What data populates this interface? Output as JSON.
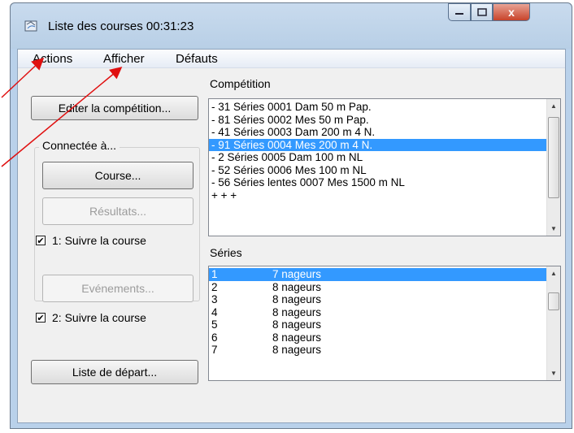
{
  "window": {
    "title": "Liste des courses  00:31:23",
    "close_glyph": "x"
  },
  "menu": {
    "items": [
      "Actions",
      "Afficher",
      "Défauts"
    ]
  },
  "left_panel": {
    "edit_button": "Editer la compétition...",
    "group_label": "Connectée à...",
    "course_button": "Course...",
    "results_button": "Résultats...",
    "follow1": "1: Suivre la course",
    "events_button": "Evénements...",
    "follow2": "2: Suivre la course",
    "start_list_button": "Liste de départ..."
  },
  "competition": {
    "label": "Compétition",
    "items": [
      "- 31 Séries 0001 Dam 50 m Pap.",
      "- 81 Séries 0002 Mes 50 m Pap.",
      "- 41 Séries 0003 Dam 200 m 4 N.",
      "- 91 Séries 0004 Mes 200 m 4 N.",
      "- 2 Séries 0005 Dam 100 m NL",
      "- 52 Séries 0006 Mes 100 m NL",
      "- 56 Séries lentes 0007 Mes 1500 m NL",
      "+ + +"
    ],
    "selected_index": 3
  },
  "series": {
    "label": "Séries",
    "rows": [
      {
        "num": "1",
        "text": "7 nageurs"
      },
      {
        "num": "2",
        "text": "8 nageurs"
      },
      {
        "num": "3",
        "text": "8 nageurs"
      },
      {
        "num": "4",
        "text": "8 nageurs"
      },
      {
        "num": "5",
        "text": "8 nageurs"
      },
      {
        "num": "6",
        "text": "8 nageurs"
      },
      {
        "num": "7",
        "text": "8 nageurs"
      }
    ],
    "selected_index": 0
  },
  "checkboxes": {
    "follow1_checked": true,
    "follow2_checked": true
  },
  "colors": {
    "selection": "#3399ff",
    "annotation_arrow": "#e01010",
    "titlebar": "#b9d1ea"
  }
}
